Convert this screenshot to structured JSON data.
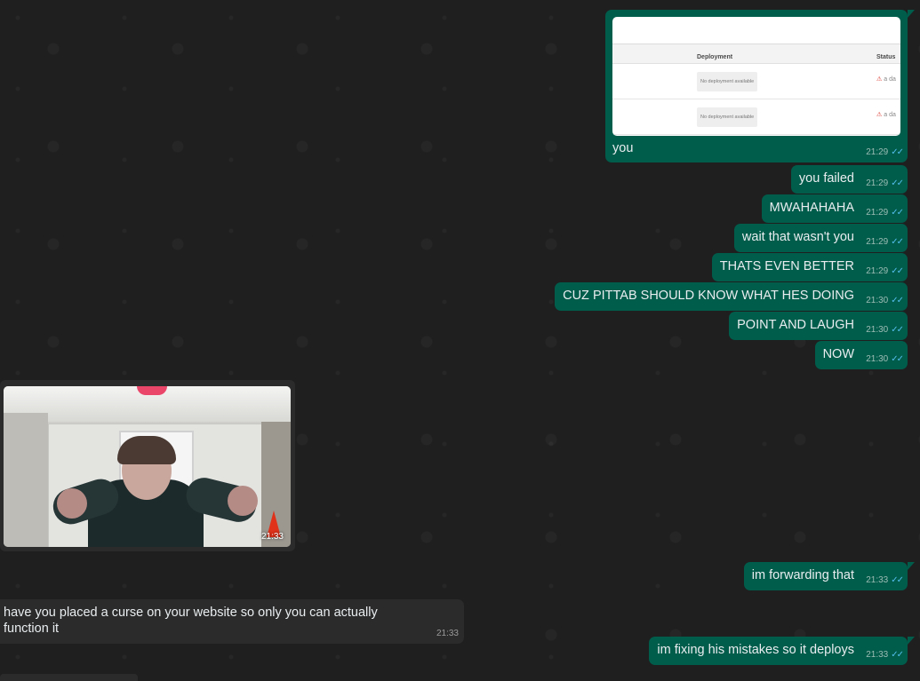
{
  "theme": {
    "background": "#1f1f1f",
    "outgoing_bubble": "#005c4b",
    "incoming_bubble": "#2b2b2b",
    "read_ticks": "#53bdeb"
  },
  "screenshot_message": {
    "table_headers": [
      "Deployment",
      "Status"
    ],
    "rows": [
      {
        "deployment": "No deployment available",
        "status_text": "a da"
      },
      {
        "deployment": "No deployment available",
        "status_text": "a da"
      }
    ],
    "caption": "you",
    "time": "21:29",
    "ticks_icon": "double-check-icon"
  },
  "outgoing_messages": [
    {
      "text": "you failed",
      "time": "21:29"
    },
    {
      "text": "MWAHAHAHA",
      "time": "21:29"
    },
    {
      "text": "wait that wasn't you",
      "time": "21:29"
    },
    {
      "text": "THATS EVEN BETTER",
      "time": "21:29"
    },
    {
      "text": "CUZ PITTAB SHOULD KNOW WHAT HES DOING",
      "time": "21:30"
    },
    {
      "text": "POINT AND LAUGH",
      "time": "21:30"
    },
    {
      "text": "NOW",
      "time": "21:30"
    }
  ],
  "video_message": {
    "time": "21:33"
  },
  "later_messages": [
    {
      "direction": "out",
      "text": "im forwarding that",
      "time": "21:33"
    },
    {
      "direction": "in",
      "text": "have you placed a curse on your website so only you can actually function it",
      "time": "21:33"
    },
    {
      "direction": "out",
      "text": "im fixing his mistakes so it deploys",
      "time": "21:33"
    }
  ],
  "ticks_symbol": "✓✓"
}
